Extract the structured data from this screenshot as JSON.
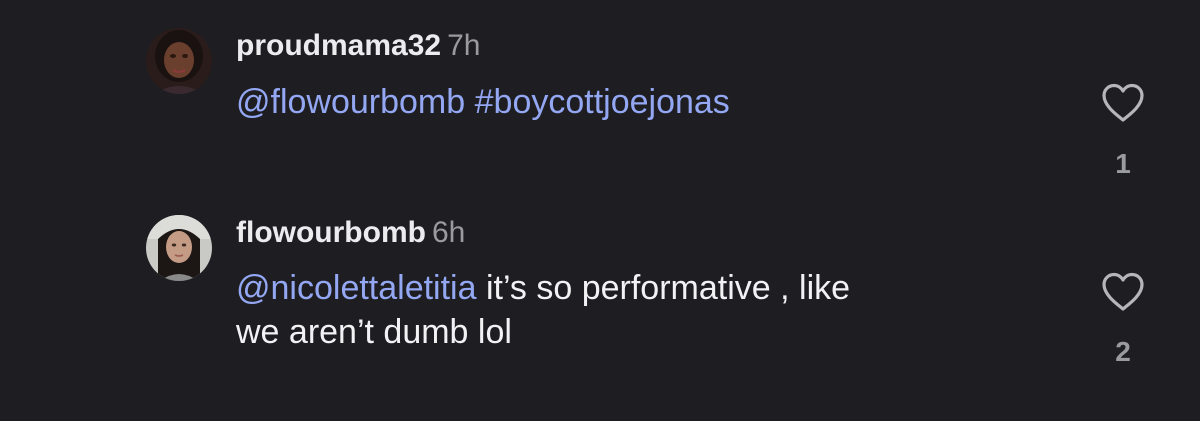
{
  "comments": [
    {
      "username": "proudmama32",
      "time": "7h",
      "text_parts": {
        "mention": "@flowourbomb",
        "hashtag": "#boycottjoejonas"
      },
      "like_icon": "heart-outline-icon",
      "likes": "1"
    },
    {
      "username": "flowourbomb",
      "time": "6h",
      "text_parts": {
        "mention": "@nicolettaletitia",
        "line1": " it’s so performative , like",
        "line2": "we aren’t dumb lol"
      },
      "like_icon": "heart-outline-icon",
      "likes": "2"
    }
  ],
  "colors": {
    "background": "#1e1e22",
    "username": "#ececef",
    "timestamp": "#9a9aa1",
    "body": "#f2f2f4",
    "link": "#93a7f3",
    "icon": "#b5b5bb"
  }
}
